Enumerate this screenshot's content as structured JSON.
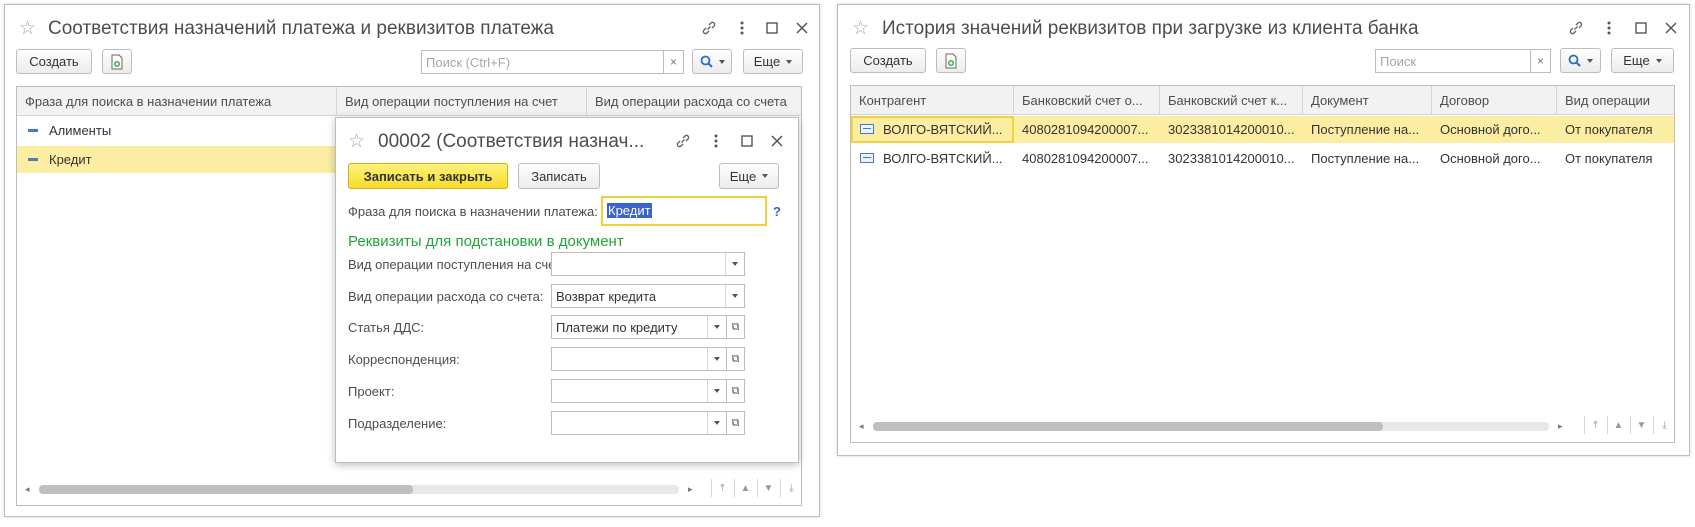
{
  "win1": {
    "title": "Соответствия назначений платежа и реквизитов платежа",
    "create_label": "Создать",
    "search_placeholder": "Поиск (Ctrl+F)",
    "more_label": "Еще",
    "columns": [
      "Фраза для поиска в назначении платежа",
      "Вид операции поступления на счет",
      "Вид операции расхода со счета"
    ],
    "rows": [
      "Алименты",
      "Кредит"
    ]
  },
  "dialog": {
    "title": "00002 (Соответствия назнач...",
    "save_close_label": "Записать и закрыть",
    "save_label": "Записать",
    "more_label": "Еще",
    "phrase_label": "Фраза для поиска в назначении платежа:",
    "phrase_value": "Кредит",
    "help_mark": "?",
    "section_title": "Реквизиты для подстановки в документ",
    "fields": [
      {
        "label": "Вид операции поступления на счет:",
        "value": ""
      },
      {
        "label": "Вид операции расхода со счета:",
        "value": "Возврат кредита"
      },
      {
        "label": "Статья ДДС:",
        "value": "Платежи по кредиту"
      },
      {
        "label": "Корреспонденция:",
        "value": ""
      },
      {
        "label": "Проект:",
        "value": ""
      },
      {
        "label": "Подразделение:",
        "value": ""
      }
    ]
  },
  "win2": {
    "title": "История значений реквизитов при загрузке из клиента банка",
    "create_label": "Создать",
    "search_placeholder": "Поиск",
    "more_label": "Еще",
    "columns": [
      "Контрагент",
      "Банковский счет о...",
      "Банковский счет к...",
      "Документ",
      "Договор",
      "Вид операции"
    ],
    "rows": [
      [
        "ВОЛГО-ВЯТСКИЙ...",
        "4080281094200007...",
        "3023381014200010...",
        "Поступление на...",
        "Основной дого...",
        "От покупателя"
      ],
      [
        "ВОЛГО-ВЯТСКИЙ...",
        "4080281094200007...",
        "3023381014200010...",
        "Поступление на...",
        "Основной дого...",
        "От покупателя"
      ]
    ]
  },
  "colors": {
    "accent_yellow": "#f6dc2d",
    "selection": "#fbeda2",
    "section_green": "#22a33c",
    "link_blue": "#2b6cc4"
  }
}
